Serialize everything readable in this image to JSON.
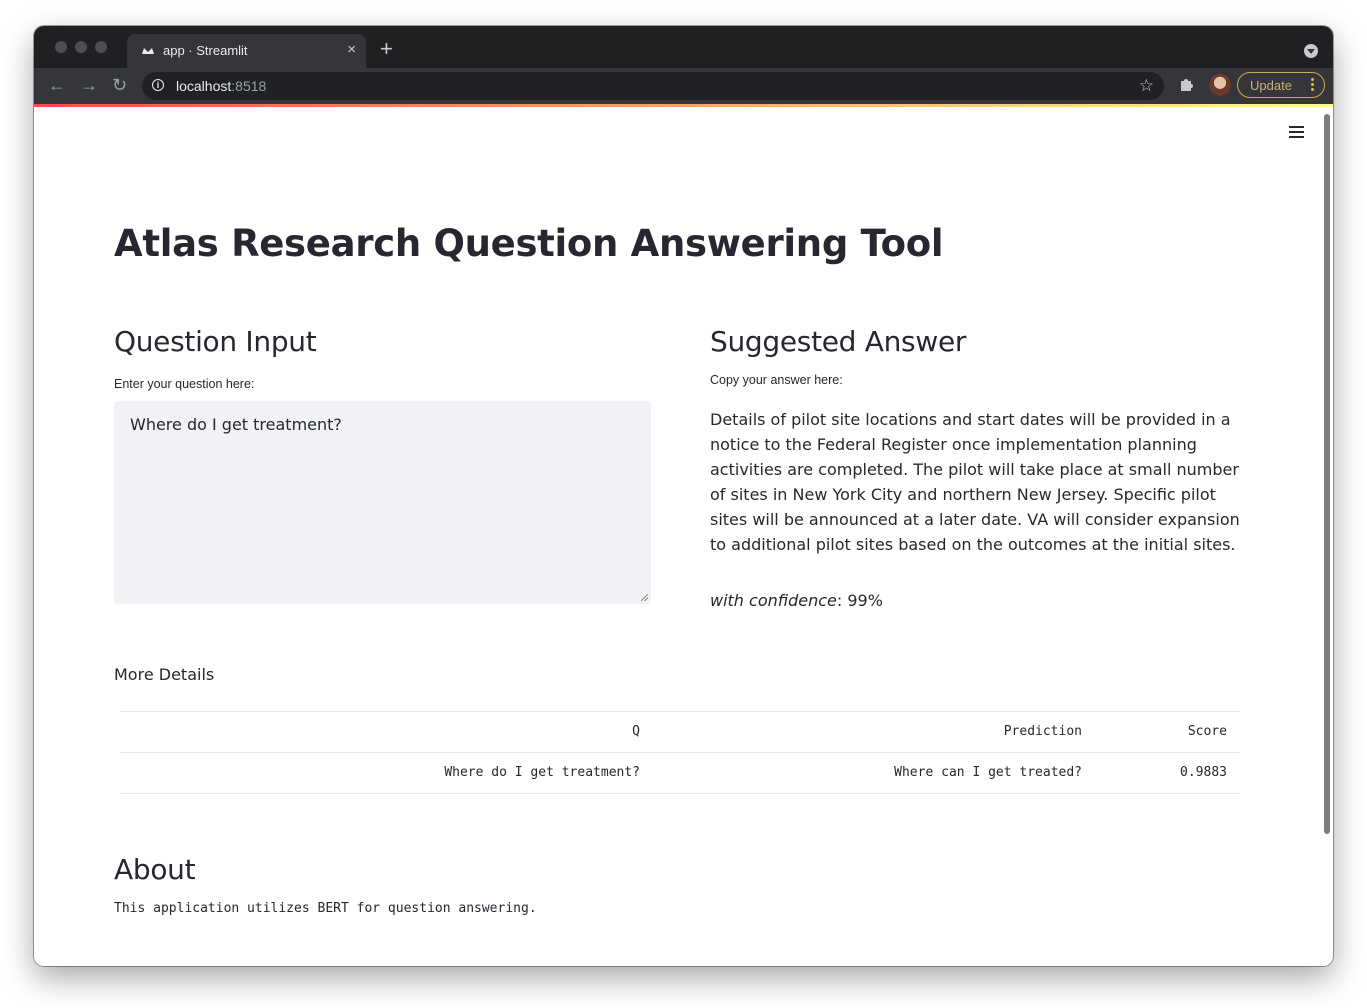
{
  "browser": {
    "tab_title": "app · Streamlit",
    "tab_close": "×",
    "new_tab": "+",
    "url_host": "localhost",
    "url_port": ":8518",
    "update_label": "Update"
  },
  "app": {
    "title": "Atlas Research Question Answering Tool",
    "question_header": "Question Input",
    "question_label": "Enter your question here:",
    "question_value": "Where do I get treatment?",
    "answer_header": "Suggested Answer",
    "answer_label": "Copy your answer here:",
    "answer_text": "Details of pilot site locations and start dates will be provided in a notice to the Federal Register once implementation planning activities are completed. The pilot will take place at small number of sites in New York City and northern New Jersey. Specific pilot sites will be announced at a later date. VA will consider expansion to additional pilot sites based on the outcomes at the initial sites.",
    "confidence_label": "with confidence",
    "confidence_value": ": 99%",
    "more_details": "More Details",
    "table": {
      "headers": [
        "Q",
        "Prediction",
        "Score"
      ],
      "rows": [
        [
          "Where do I get treatment?",
          "Where can I get treated?",
          "0.9883"
        ]
      ]
    },
    "about_header": "About",
    "about_text": "This application utilizes BERT for question answering."
  },
  "colors": {
    "accent": "#ff4b4b",
    "text": "#262730",
    "input_bg": "#f0f2f6"
  }
}
